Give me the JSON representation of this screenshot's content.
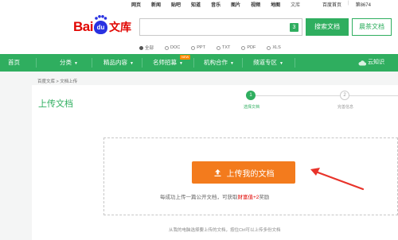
{
  "topbar": {
    "links": [
      "网页",
      "新闻",
      "贴吧",
      "知道",
      "音乐",
      "图片",
      "视频",
      "地图",
      "文库"
    ],
    "right": [
      "百度首页",
      "第8674"
    ]
  },
  "logo": {
    "bai": "Bai",
    "du": "du",
    "wenku": "文库"
  },
  "search": {
    "badge": "3",
    "search_button": "搜索文档",
    "show_button": "晨茶文档"
  },
  "filters": {
    "options": [
      "全部",
      "DOC",
      "PPT",
      "TXT",
      "PDF",
      "XLS"
    ],
    "selected": "全部"
  },
  "nav": {
    "home": "首页",
    "items": [
      "分类",
      "精品内容",
      "名师招募",
      "机构合作",
      "频道专区"
    ],
    "hot_badge": "NEW",
    "cloud": "云知识"
  },
  "breadcrumb": "百度文库 > 文档上传",
  "page_title": "上传文档",
  "steps": {
    "step1_num": "1",
    "step1_label": "选择文档",
    "step2_num": "2",
    "step2_label": "完善信息"
  },
  "upload": {
    "button_label": "上传我的文档",
    "reward_prefix": "每成功上传一篇公开文档，可获取",
    "reward_highlight": "财富值+2",
    "reward_suffix": "奖励",
    "hint": "从我的电脑选择要上传的文档，按住Ctrl可以上传多份文档"
  },
  "colors": {
    "brand": "#2fae5f",
    "upload": "#f37b1d",
    "annotation": "#e8332a"
  }
}
